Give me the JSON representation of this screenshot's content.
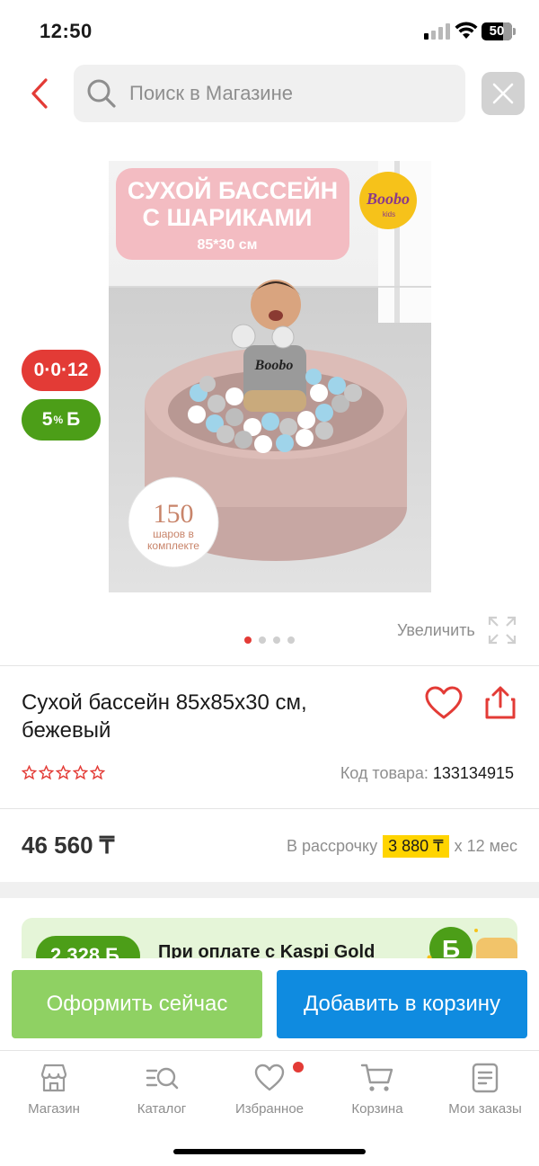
{
  "status_bar": {
    "time": "12:50",
    "battery": "50"
  },
  "search": {
    "placeholder": "Поиск в Магазине"
  },
  "product_image": {
    "banner_line1": "СУХОЙ БАССЕЙН",
    "banner_line2": "С ШАРИКАМИ",
    "banner_size": "85*30 см",
    "brand_logo": "Boobo",
    "brand_sub": "kids",
    "shirt_text": "Boobo",
    "balls_count": "150",
    "balls_caption_1": "шаров в",
    "balls_caption_2": "комплекте"
  },
  "badges": {
    "installment": "0·0·12",
    "bonus_value": "5",
    "bonus_percent": "%",
    "bonus_currency": "Б"
  },
  "gallery": {
    "zoom_label": "Увеличить",
    "dot_count": 4,
    "active_dot": 0
  },
  "product": {
    "title": "Сухой бассейн 85x85x30 см, бежевый",
    "rating": 0,
    "code_label": "Код товара:",
    "code_value": "133134915",
    "price": "46 560 ₸",
    "installment_prefix": "В рассрочку",
    "installment_amount": "3 880 ₸",
    "installment_suffix": "x 12 мес"
  },
  "promo": {
    "bonus_amount": "2 328 Б",
    "text": "При оплате с Kaspi Gold",
    "coin_symbol": "Б"
  },
  "actions": {
    "buy_now": "Оформить сейчас",
    "add_to_cart": "Добавить в корзину"
  },
  "tabbar": {
    "items": [
      {
        "label": "Магазин",
        "icon": "store-icon"
      },
      {
        "label": "Каталог",
        "icon": "catalog-search-icon"
      },
      {
        "label": "Избранное",
        "icon": "heart-icon"
      },
      {
        "label": "Корзина",
        "icon": "cart-icon"
      },
      {
        "label": "Мои заказы",
        "icon": "orders-icon"
      }
    ]
  },
  "colors": {
    "accent_red": "#e33b36",
    "bonus_green": "#4c9e18",
    "buy_now_green": "#8fd163",
    "cart_blue": "#0f8be0",
    "installment_yellow": "#ffd400"
  }
}
